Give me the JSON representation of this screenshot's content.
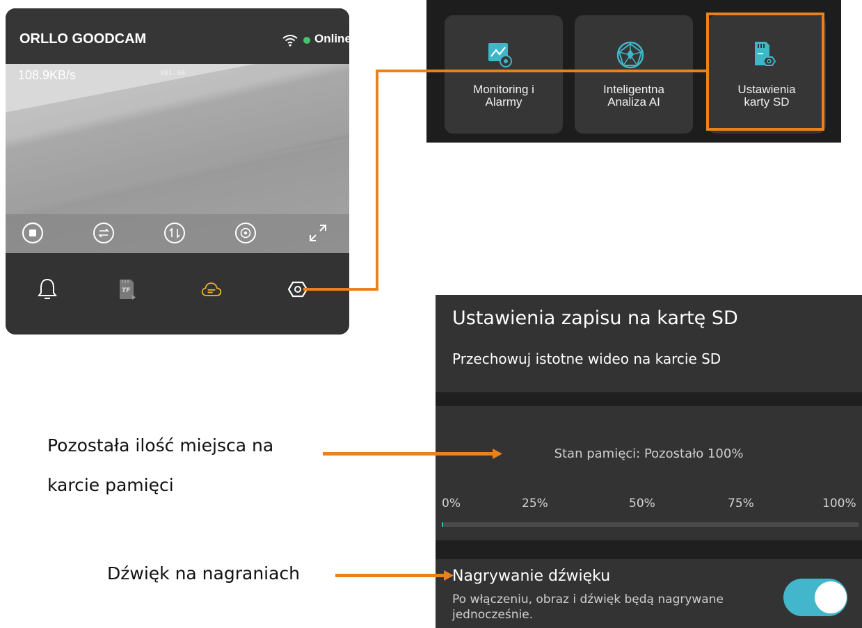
{
  "camera": {
    "title": "ORLLO GOODCAM",
    "status": "Online",
    "status_color": "#46c46b",
    "speed": "108.9KB/s",
    "zoom": "X01.00",
    "controls": [
      "stop-icon",
      "switch-icon",
      "ptz-icon",
      "record-icon",
      "fullscreen-icon"
    ],
    "tools": [
      "bell-icon",
      "tf-card-icon",
      "cloud-icon",
      "settings-icon"
    ],
    "active_tool_color": "#f0b12a"
  },
  "menu": {
    "cards": [
      {
        "label": "Monitoring i\nAlarmy",
        "icon": "monitoring-icon"
      },
      {
        "label": "Inteligentna\nAnaliza AI",
        "icon": "ai-analysis-icon"
      },
      {
        "label": "Ustawienia\nkarty SD",
        "icon": "sd-card-settings-icon"
      }
    ]
  },
  "sd_settings": {
    "title": "Ustawienia zapisu na kartę SD",
    "subtitle": "Przechowuj istotne wideo na karcie SD",
    "memory_status": "Stan pamięci: Pozostało 100%",
    "ticks": [
      "0%",
      "25%",
      "50%",
      "75%",
      "100%"
    ],
    "used_fraction": 0.003,
    "audio_title": "Nagrywanie dźwięku",
    "audio_desc": "Po włączeniu, obraz i dźwięk będą nagrywane jednocześnie.",
    "audio_enabled": true,
    "accent_color": "#43b6cc"
  },
  "annotations": {
    "memory_line1": "Pozostała ilość miejsca na",
    "memory_line2": "karcie pamięci",
    "audio": "Dźwięk na nagraniach",
    "color": "#e9821c"
  }
}
